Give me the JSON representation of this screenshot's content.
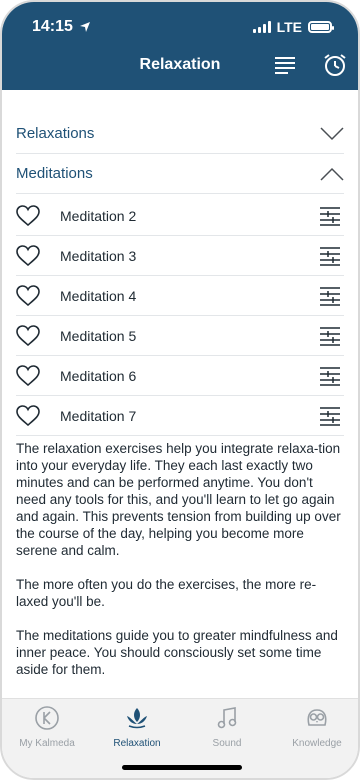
{
  "status": {
    "time": "14:15",
    "network": "LTE"
  },
  "header": {
    "title": "Relaxation",
    "menu_icon": "list-icon",
    "alarm_icon": "alarm-clock-icon"
  },
  "sections": [
    {
      "label": "Relaxations",
      "state": "collapsed"
    },
    {
      "label": "Meditations",
      "state": "expanded"
    }
  ],
  "meditations": [
    {
      "label": "Meditation 2"
    },
    {
      "label": "Meditation 3"
    },
    {
      "label": "Meditation 4"
    },
    {
      "label": "Meditation 5"
    },
    {
      "label": "Meditation 6"
    },
    {
      "label": "Meditation 7"
    }
  ],
  "description": [
    "The relaxation exercises help you integrate relaxa-tion into your everyday life. They each last exactly two minutes and can be performed anytime. You don't need any tools for this, and you'll learn to let go again and again. This prevents tension from building up over the course of the day, helping you become more serene and calm.",
    "The more often you do the exercises, the more re-laxed you'll be.",
    "The meditations guide you to greater mindfulness and inner peace. You should consciously set some time aside for them."
  ],
  "tabs": [
    {
      "label": "My Kalmeda",
      "icon": "kalmeda-logo-icon",
      "active": false
    },
    {
      "label": "Relaxation",
      "icon": "lotus-icon",
      "active": true
    },
    {
      "label": "Sound",
      "icon": "music-note-icon",
      "active": false
    },
    {
      "label": "Knowledge",
      "icon": "owl-icon",
      "active": false
    }
  ],
  "colors": {
    "primary": "#1f5176",
    "inactive": "#9aa0a6",
    "tabbar": "#f2f2f2"
  }
}
